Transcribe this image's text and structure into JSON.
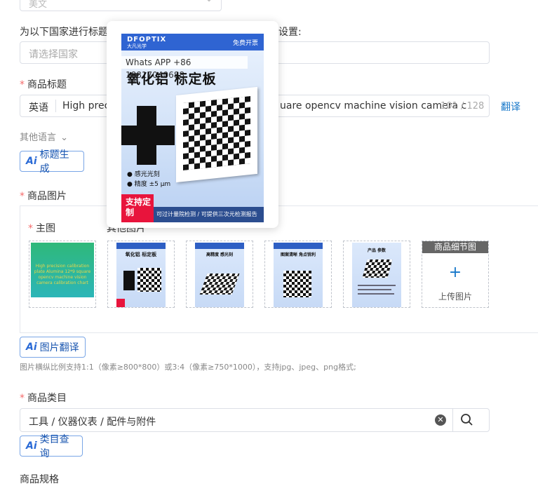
{
  "top_select": {
    "value": "美文"
  },
  "country": {
    "label": "为以下国家进行标题",
    "label_suffix": "设置:",
    "placeholder": "请选择国家"
  },
  "title": {
    "label": "商品标题",
    "lang": "英语",
    "value_left": "High preci",
    "value_right": "uare opencv machine vision camera c",
    "count": "101 / 128",
    "translate": "翻译"
  },
  "other_lang": {
    "label": "其他语言"
  },
  "ai_title_btn": {
    "ai": "Ai",
    "label": "标题生成"
  },
  "images": {
    "label": "商品图片",
    "main_label": "主图",
    "other_label": "其他图片",
    "main_thumb_text": "High precision calibration plate Alumina 12*9 square opencv machine vision camera calibration chart",
    "thumb_titles": [
      "氧化铝 标定板",
      "高精度 感光刻",
      "图案清晰 角点锐利",
      "产品 参数"
    ],
    "detail_header": "商品细节图",
    "upload_plus": "+",
    "upload_label": "上传图片"
  },
  "popup": {
    "brand": "DFOPTIX",
    "brand_cn": "大凡光学",
    "free_tag": "免费开票",
    "whatsapp": "Whats APP +86 18817040688",
    "title": "氧化铝 标定板",
    "bullet1": "感光光刻",
    "bullet2": "精度 ±5 μm",
    "red_badge": "支持定制",
    "footer": "可过计量院检测 / 可提供三次元检测报告"
  },
  "img_translate_btn": {
    "ai": "Ai",
    "label": "图片翻译"
  },
  "img_hint": "图片横纵比例支持1:1（像素≥800*800）或3:4（像素≥750*1000），支持jpg、jpeg、png格式;",
  "category": {
    "label": "商品类目",
    "value": "工具 / 仪器仪表 / 配件与附件"
  },
  "ai_cat_btn": {
    "ai": "Ai",
    "label": "类目查询"
  },
  "bottom_label": "商品规格",
  "colors": {
    "accent": "#1677c9",
    "required": "#f56c6c",
    "border": "#dcdfe6"
  }
}
